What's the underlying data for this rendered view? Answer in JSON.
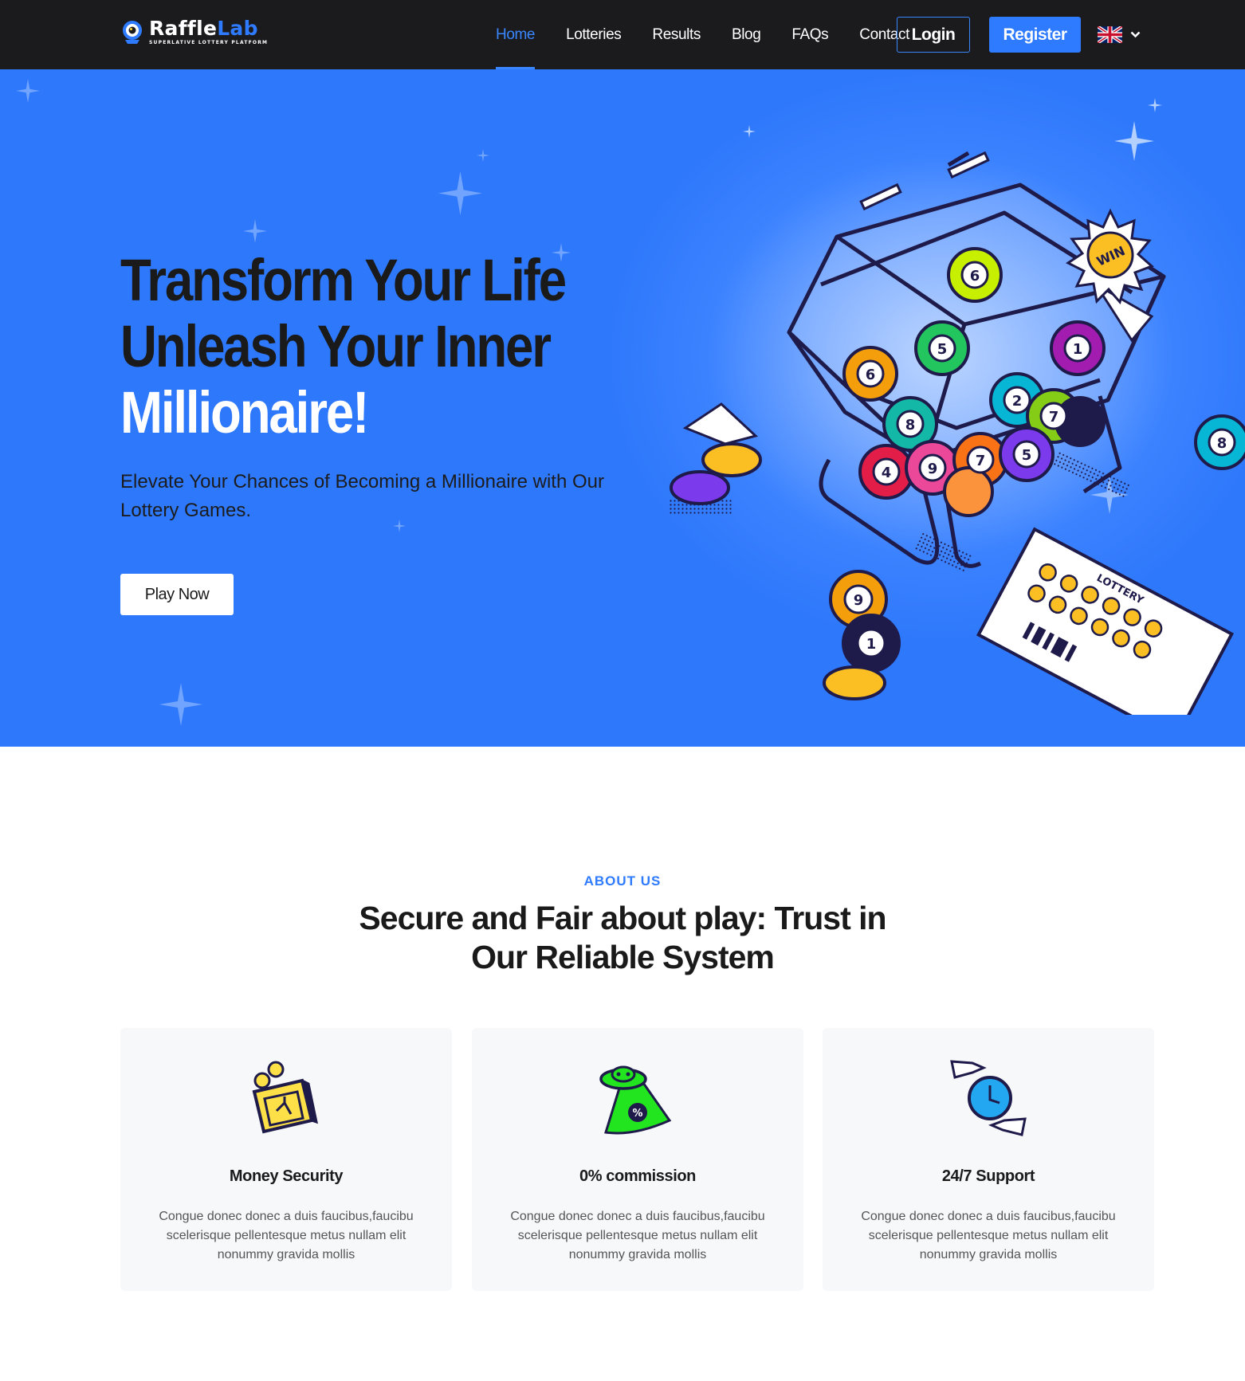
{
  "brand": {
    "name_part1": "Raffle",
    "name_part2": "Lab",
    "tagline": "SUPERLATIVE LOTTERY PLATFORM"
  },
  "nav": {
    "items": [
      {
        "label": "Home",
        "active": true
      },
      {
        "label": "Lotteries",
        "active": false
      },
      {
        "label": "Results",
        "active": false
      },
      {
        "label": "Blog",
        "active": false
      },
      {
        "label": "FAQs",
        "active": false
      },
      {
        "label": "Contact",
        "active": false
      }
    ],
    "login_label": "Login",
    "register_label": "Register",
    "language_icon": "uk-flag-icon"
  },
  "hero": {
    "title_line1": "Transform Your Life",
    "title_line2": "Unleash Your Inner",
    "title_line3": "Millionaire!",
    "subtitle": "Elevate Your Chances of Becoming a Millionaire with Our Lottery Games.",
    "cta_label": "Play Now",
    "illustration_labels": {
      "win": "WIN",
      "ticket": "LOTTERY"
    }
  },
  "about": {
    "eyebrow": "ABOUT US",
    "title": "Secure and Fair about play: Trust in Our Reliable System",
    "cards": [
      {
        "icon": "safe-coins-icon",
        "title": "Money Security",
        "text": "Congue donec donec a duis faucibus,faucibu scelerisque pellentesque metus nullam elit nonummy gravida mollis"
      },
      {
        "icon": "ufo-percent-icon",
        "title": "0% commission",
        "text": "Congue donec donec a duis faucibus,faucibu scelerisque pellentesque metus nullam elit nonummy gravida mollis"
      },
      {
        "icon": "clock-hands-icon",
        "title": "24/7 Support",
        "text": "Congue donec donec a duis faucibus,faucibu scelerisque pellentesque metus nullam elit nonummy gravida mollis"
      }
    ]
  },
  "colors": {
    "accent": "#2f7bff",
    "nav_bg": "#1b1b1d",
    "hero_bg": "#3b82ff",
    "card_bg": "#f7f8fa"
  }
}
